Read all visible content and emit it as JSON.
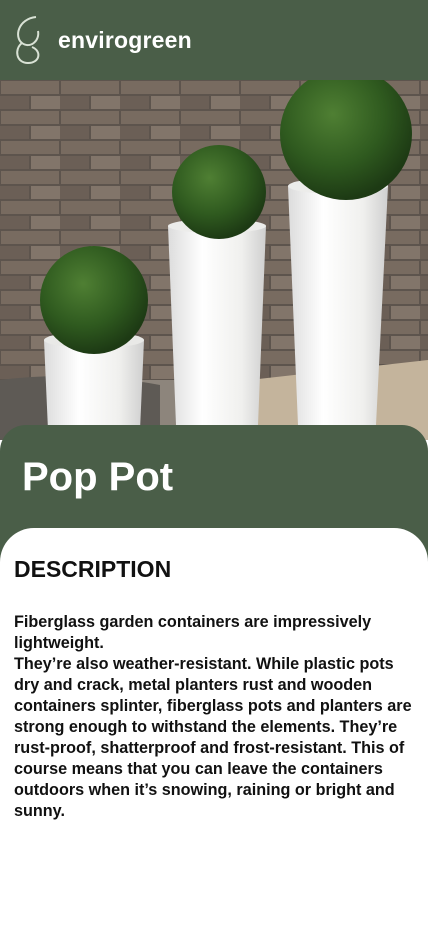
{
  "header": {
    "brand": "envirogreen",
    "logo_icon": "leaf-g-logo-icon"
  },
  "hero": {
    "image": "three-white-planters-with-topiary-balls",
    "colors": {
      "wall": "#6f6258",
      "planter": "#f2f2f0",
      "foliage": "#2f5a1f"
    }
  },
  "product": {
    "title": "Pop Pot"
  },
  "description": {
    "heading": "DESCRIPTION",
    "paragraph_1": "Fiberglass garden containers are impressively lightweight.",
    "paragraph_2": "They’re also weather-resistant. While plastic pots dry and crack, metal planters rust and wooden containers splinter, fiberglass pots and planters are strong enough to withstand the elements. They’re rust-proof, shatterproof and frost-resistant. This of course means that you can leave the containers outdoors when it’s snowing, raining or bright and sunny."
  },
  "theme": {
    "primary": "#4a5e48",
    "background": "#ffffff",
    "text": "#111111"
  }
}
